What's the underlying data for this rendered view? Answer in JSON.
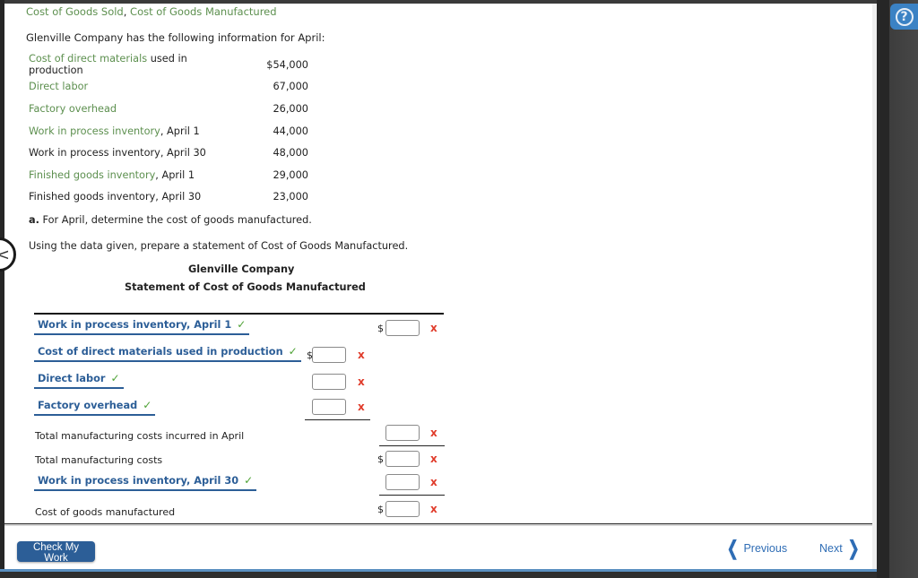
{
  "header": {
    "topic_part1": "Cost of Goods Sold",
    "topic_sep": ", ",
    "topic_part2": "Cost of Goods Manufactured"
  },
  "help": {
    "icon": "help-icon",
    "glyph": "?"
  },
  "problem": {
    "intro": "Glenville Company has the following information for April:",
    "rows": [
      {
        "label_green": "Cost of direct materials",
        "label_rest": " used in production",
        "value": "$54,000"
      },
      {
        "label_green": "Direct labor",
        "label_rest": "",
        "value": "67,000"
      },
      {
        "label_green": "Factory overhead",
        "label_rest": "",
        "value": "26,000"
      },
      {
        "label_green": "Work in process inventory",
        "label_rest": ", April 1",
        "value": "44,000"
      },
      {
        "label_green": "",
        "label_rest": "Work in process inventory, April 30",
        "value": "48,000"
      },
      {
        "label_green": "Finished goods inventory",
        "label_rest": ", April 1",
        "value": "29,000"
      },
      {
        "label_green": "",
        "label_rest": "Finished goods inventory, April 30",
        "value": "23,000"
      }
    ],
    "part_a_letter": "a.",
    "part_a_text": " For April, determine the cost of goods manufactured.",
    "instructions": "Using the data given, prepare a statement of Cost of Goods Manufactured."
  },
  "statement": {
    "company": "Glenville Company",
    "title": "Statement of Cost of Goods Manufactured",
    "currency_symbol": "$",
    "check_glyph": "✓",
    "wrong_glyph": "x",
    "lines": {
      "wip_begin": "Work in process inventory, April 1",
      "direct_materials": "Cost of direct materials used in production",
      "direct_labor": "Direct labor",
      "factory_overhead": "Factory overhead",
      "total_incurred": "Total manufacturing costs incurred in April",
      "total_costs": "Total manufacturing costs",
      "wip_end": "Work in process inventory, April 30",
      "cogm": "Cost of goods manufactured"
    },
    "inputs": {
      "wip_begin": "",
      "direct_materials": "",
      "direct_labor": "",
      "factory_overhead": "",
      "total_incurred": "",
      "total_costs": "",
      "wip_end": "",
      "cogm": ""
    }
  },
  "footer": {
    "check_my_work": "Check My Work",
    "previous": "Previous",
    "next": "Next"
  }
}
